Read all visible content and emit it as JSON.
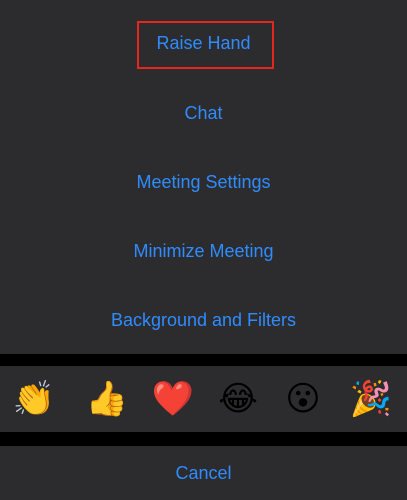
{
  "menu": {
    "items": [
      {
        "label": "Raise Hand"
      },
      {
        "label": "Chat"
      },
      {
        "label": "Meeting Settings"
      },
      {
        "label": "Minimize Meeting"
      },
      {
        "label": "Background and Filters"
      }
    ]
  },
  "reactions": {
    "items": [
      {
        "emoji": "👏",
        "icon": "clapping-hands-icon"
      },
      {
        "emoji": "👍",
        "icon": "thumbs-up-icon"
      },
      {
        "emoji": "❤️",
        "icon": "red-heart-icon"
      },
      {
        "emoji": "😂",
        "icon": "tears-of-joy-icon"
      },
      {
        "emoji": "😮",
        "icon": "open-mouth-face-icon"
      },
      {
        "emoji": "🎉",
        "icon": "party-popper-icon"
      }
    ]
  },
  "cancel": {
    "label": "Cancel"
  },
  "colors": {
    "background": "#000000",
    "sheet": "#2c2c2e",
    "accent": "#2f8cff",
    "highlight_border": "#e3271c"
  }
}
